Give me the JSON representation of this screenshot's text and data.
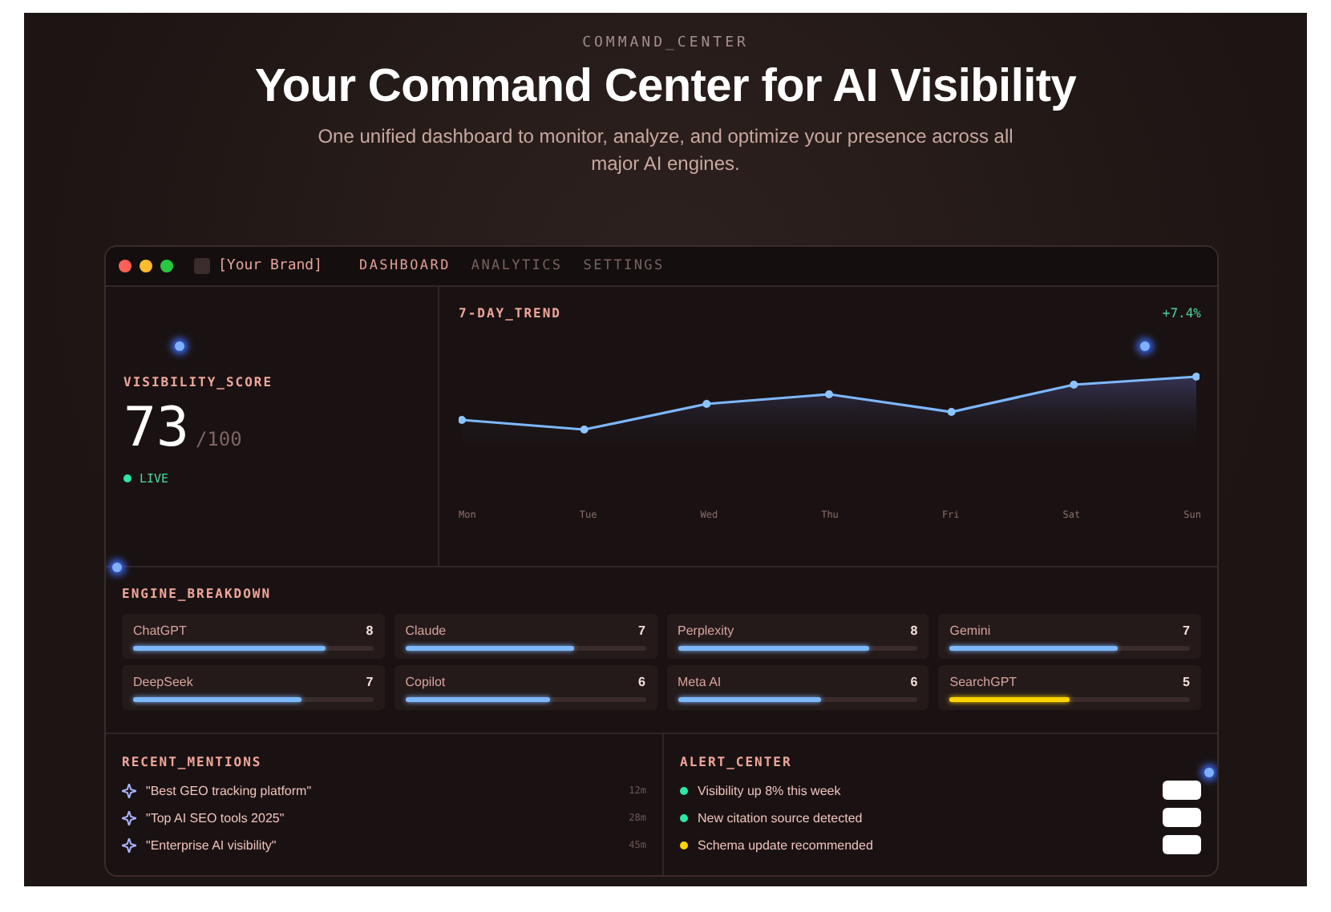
{
  "eyebrow": "COMMAND_CENTER",
  "headline": "Your Command Center for AI Visibility",
  "subtitle": "One unified dashboard to monitor, analyze, and optimize your presence across all major AI engines.",
  "window": {
    "brand": "[Your Brand]",
    "tabs": [
      {
        "label": "DASHBOARD",
        "selected": true
      },
      {
        "label": "ANALYTICS",
        "selected": false
      },
      {
        "label": "SETTINGS",
        "selected": false
      }
    ]
  },
  "score": {
    "title": "VISIBILITY_SCORE",
    "value": "73",
    "max": "/100",
    "status": "LIVE"
  },
  "trend": {
    "title": "7-DAY_TREND",
    "change": "+7.4%",
    "days": [
      "Mon",
      "Tue",
      "Wed",
      "Thu",
      "Fri",
      "Sat",
      "Sun"
    ]
  },
  "engines": {
    "title": "ENGINE_BREAKDOWN",
    "items": [
      {
        "name": "ChatGPT",
        "score": "8",
        "level": 0.8,
        "color": "#7eb8ff"
      },
      {
        "name": "Claude",
        "score": "7",
        "level": 0.7,
        "color": "#7eb8ff"
      },
      {
        "name": "Perplexity",
        "score": "8",
        "level": 0.8,
        "color": "#7eb8ff"
      },
      {
        "name": "Gemini",
        "score": "7",
        "level": 0.7,
        "color": "#7eb8ff"
      },
      {
        "name": "DeepSeek",
        "score": "7",
        "level": 0.7,
        "color": "#7eb8ff"
      },
      {
        "name": "Copilot",
        "score": "6",
        "level": 0.6,
        "color": "#7eb8ff"
      },
      {
        "name": "Meta AI",
        "score": "6",
        "level": 0.6,
        "color": "#7eb8ff"
      },
      {
        "name": "SearchGPT",
        "score": "5",
        "level": 0.5,
        "color": "#ffd400"
      }
    ]
  },
  "mentions": {
    "title": "RECENT_MENTIONS",
    "items": [
      {
        "text": "\"Best GEO tracking platform\"",
        "time": "12m"
      },
      {
        "text": "\"Top AI SEO tools 2025\"",
        "time": "28m"
      },
      {
        "text": "\"Enterprise AI visibility\"",
        "time": "45m"
      }
    ]
  },
  "alerts": {
    "title": "ALERT_CENTER",
    "items": [
      {
        "text": "Visibility up 8% this week",
        "color": "#2ee6a8"
      },
      {
        "text": "New citation source detected",
        "color": "#2ee6a8"
      },
      {
        "text": "Schema update recommended",
        "color": "#ffd400"
      }
    ]
  }
}
